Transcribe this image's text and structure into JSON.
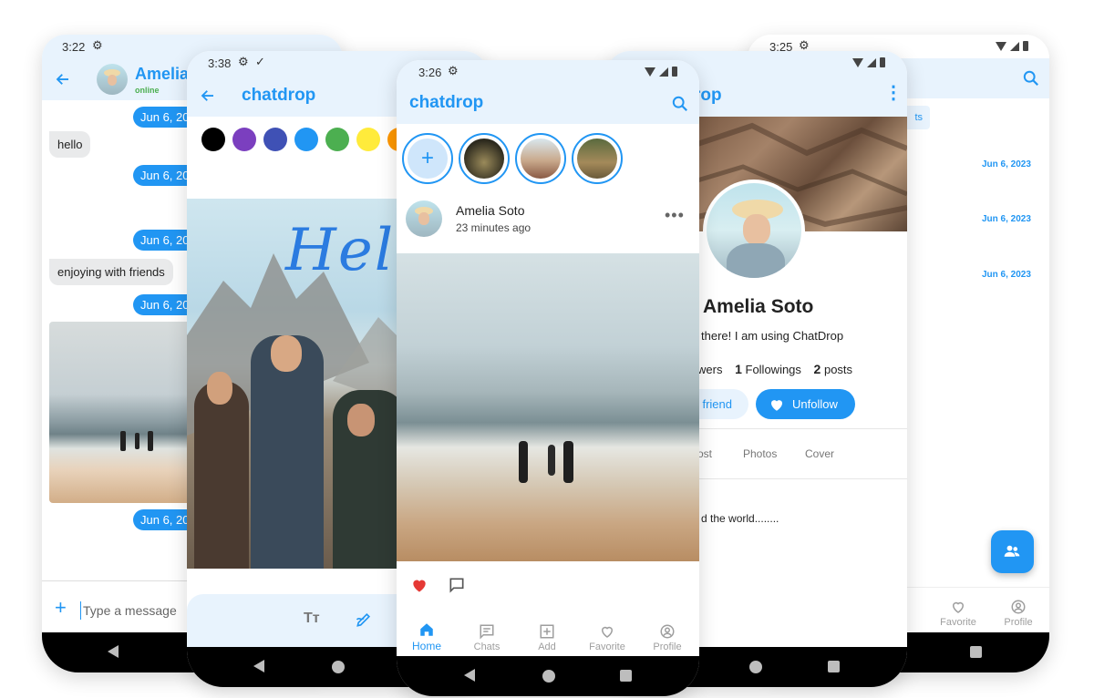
{
  "colors": {
    "accent": "#2196f3",
    "light_blue": "#e8f3fd",
    "heart": "#e53935"
  },
  "phone1": {
    "time": "3:22",
    "contact_name": "Amelia",
    "contact_status": "online",
    "messages": [
      {
        "type": "date",
        "text": "Jun 6, 2023"
      },
      {
        "type": "received",
        "text": "hello"
      },
      {
        "type": "date",
        "text": "Jun 6, 2023"
      },
      {
        "type": "date",
        "text": "Jun 6, 2023"
      },
      {
        "type": "received",
        "text": "enjoying with friends"
      },
      {
        "type": "date",
        "text": "Jun 6, 2023"
      },
      {
        "type": "date",
        "text": "Jun 6, 2023"
      }
    ],
    "input_placeholder": "Type a message"
  },
  "phone2": {
    "time": "3:38",
    "title": "chatdrop",
    "palette": [
      "#000000",
      "#7b3fbf",
      "#3f51b5",
      "#2196f3",
      "#4caf50",
      "#ffeb3b",
      "#ff9800"
    ],
    "handwriting": "Hello"
  },
  "phone3": {
    "time": "3:26",
    "app_title": "chatdrop",
    "post_author": "Amelia Soto",
    "post_time": "23 minutes ago",
    "liked": true,
    "tabs": [
      {
        "label": "Home",
        "icon": "home-icon",
        "active": true
      },
      {
        "label": "Chats",
        "icon": "chats-icon",
        "active": false
      },
      {
        "label": "Add",
        "icon": "add-icon",
        "active": false
      },
      {
        "label": "Favorite",
        "icon": "heart-outline-icon",
        "active": false
      },
      {
        "label": "Profile",
        "icon": "profile-icon",
        "active": false
      }
    ]
  },
  "phone4": {
    "title_partial": "rop",
    "name": "Amelia Soto",
    "bio_partial": "there! I am using ChatDrop",
    "followers_label_partial": "wers",
    "followings_count": "1",
    "followings_label": "Followings",
    "posts_count": "2",
    "posts_label": "posts",
    "friend_button_partial": "friend",
    "unfollow_label": "Unfollow",
    "tabs": [
      "ost",
      "Photos",
      "Cover"
    ],
    "post_text_partial": "d the world........"
  },
  "phone5": {
    "time": "3:25",
    "chip_partial": "ts",
    "dates": [
      "Jun 6, 2023",
      "Jun 6, 2023",
      "Jun 6, 2023"
    ],
    "tabs": [
      {
        "label": "Favorite",
        "icon": "heart-outline-icon"
      },
      {
        "label": "Profile",
        "icon": "profile-icon"
      }
    ]
  }
}
